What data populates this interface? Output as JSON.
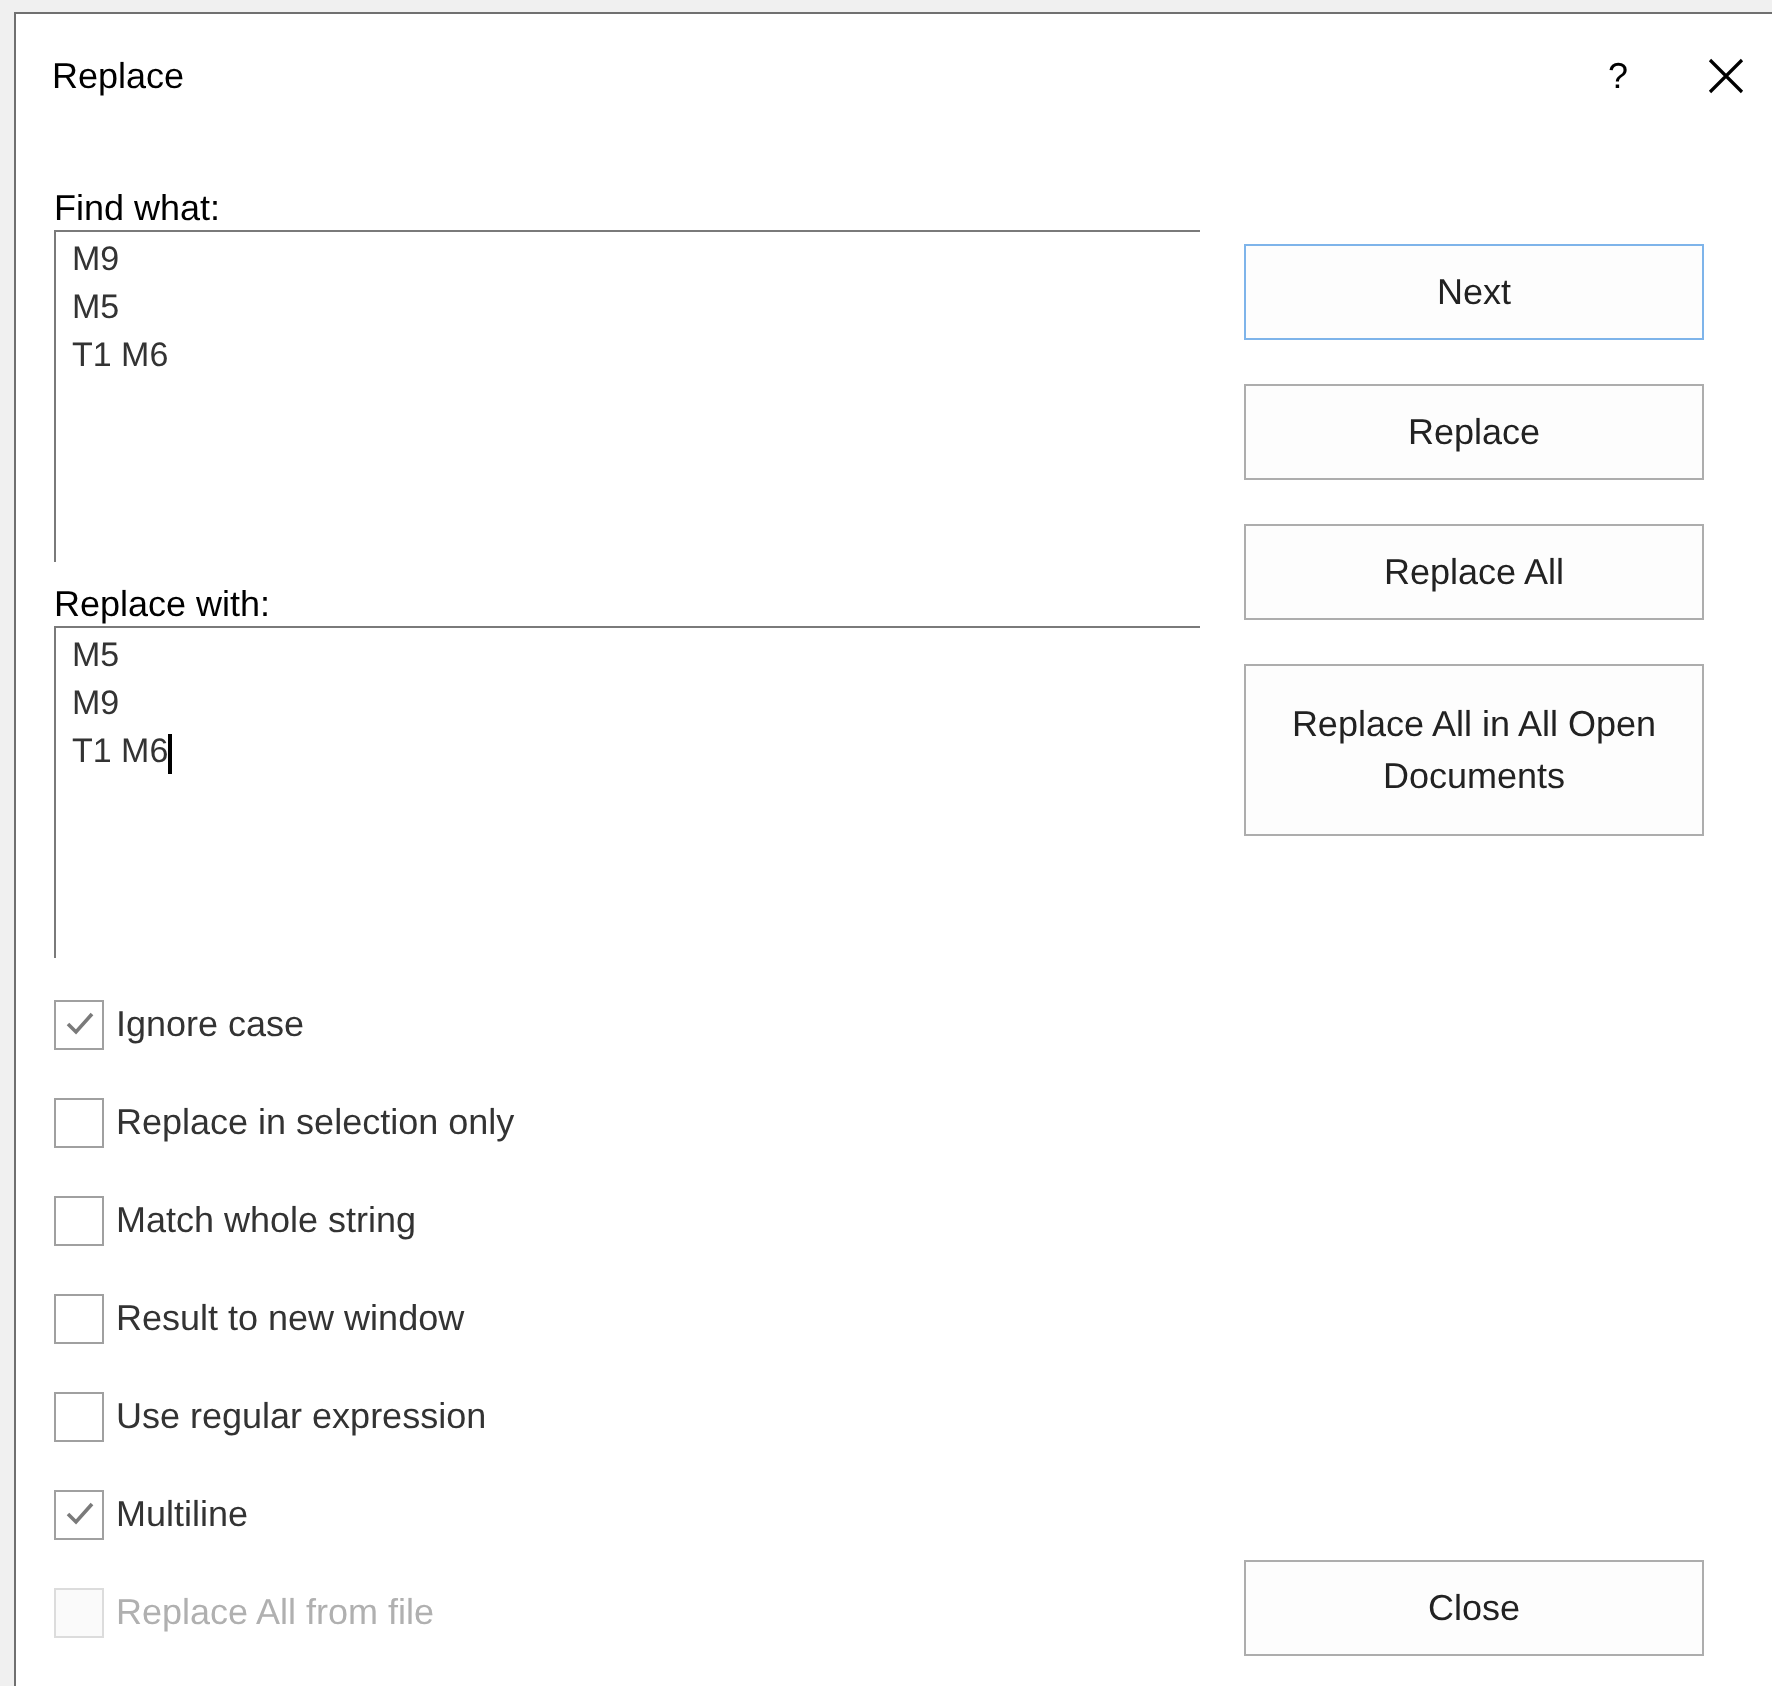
{
  "window": {
    "title": "Replace",
    "help": "?"
  },
  "find": {
    "label": "Find what:",
    "value": "M9\nM5\nT1 M6",
    "focused": false
  },
  "replace": {
    "label": "Replace with:",
    "value": "M5\nM9\nT1 M6",
    "focused": true
  },
  "buttons": [
    {
      "label": "Next",
      "default": true
    },
    {
      "label": "Replace",
      "default": false
    },
    {
      "label": "Replace All",
      "default": false
    },
    {
      "label": "Replace All in All Open Documents",
      "default": false
    }
  ],
  "options": [
    {
      "label": "Ignore case",
      "checked": true,
      "disabled": false
    },
    {
      "label": "Replace in selection only",
      "checked": false,
      "disabled": false
    },
    {
      "label": "Match whole string",
      "checked": false,
      "disabled": false
    },
    {
      "label": "Result to new window",
      "checked": false,
      "disabled": false
    },
    {
      "label": "Use regular expression",
      "checked": false,
      "disabled": false
    },
    {
      "label": "Multiline",
      "checked": true,
      "disabled": false
    },
    {
      "label": "Replace All from file",
      "checked": false,
      "disabled": true
    }
  ],
  "close_button": {
    "label": "Close"
  }
}
